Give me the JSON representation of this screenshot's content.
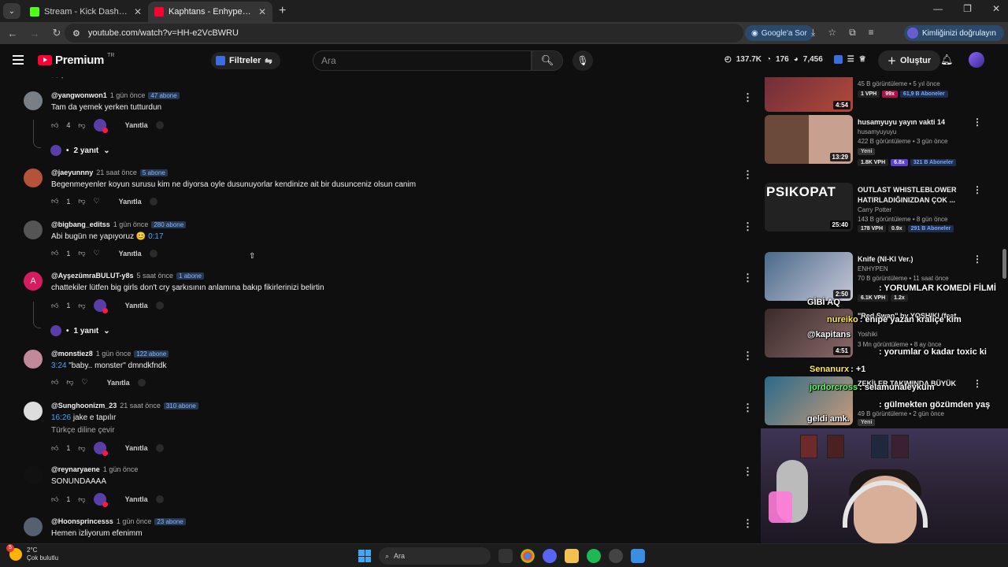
{
  "browser": {
    "tabs": [
      {
        "label": "Stream - Kick Dashboard",
        "favicon_color": "#53fc18",
        "active": false
      },
      {
        "label": "Kaphtans - Enhypen'in Yeni Albü",
        "favicon_color": "#ff0033",
        "active": true
      }
    ],
    "url": "youtube.com/watch?v=HH-e2VcBWRU",
    "google_button": "Google'a Sor",
    "profile_label": "Kimliğinizi doğrulayın"
  },
  "youtube": {
    "logo_text": "Premium",
    "region": "TR",
    "filters_label": "Filtreler",
    "search_placeholder": "Ara",
    "stats": {
      "views": "137.7K",
      "likes": "176",
      "comments": "7,456"
    },
    "create_label": "Oluştur"
  },
  "comments": [
    {
      "user": "@yangwonwon1",
      "time": "1 gün önce",
      "badge": "47 abone",
      "text": "Tam da yemek yerken tutturdun",
      "ts": "",
      "likes": "4",
      "reply": "Yanıtla",
      "creator_heart": true,
      "replies_label": "2 yanıt",
      "avatar_color": "#7a7f87"
    },
    {
      "user": "@jaeyunnny",
      "time": "21 saat önce",
      "badge": "5 abone",
      "text": "Begenmeyenler koyun surusu kim ne diyorsa oyle dusunuyorlar kendinize ait bir dusunceniz olsun canim",
      "ts": "",
      "likes": "1",
      "reply": "Yanıtla",
      "creator_heart": false,
      "replies_label": "",
      "avatar_color": "#b5533a"
    },
    {
      "user": "@bigbang_editss",
      "time": "1 gün önce",
      "badge": "280 abone",
      "text": "Abi bugün ne yapıyoruz 😊",
      "ts": "0:17",
      "likes": "1",
      "reply": "Yanıtla",
      "creator_heart": false,
      "replies_label": "",
      "avatar_color": "#555555"
    },
    {
      "user": "@AyşezümraBULUT-y8s",
      "time": "5 saat önce",
      "badge": "1 abone",
      "text": "chattekiler lütfen big girls don't cry şarkısının anlamına bakıp fikirlerinizi belirtin",
      "ts": "",
      "likes": "1",
      "reply": "Yanıtla",
      "creator_heart": true,
      "replies_label": "1 yanıt",
      "avatar_color": "#d81b60",
      "avatar_letter": "A"
    },
    {
      "user": "@monstiez8",
      "time": "1 gün önce",
      "badge": "122 abone",
      "text": "\"baby.. monster\" dmndkfndk",
      "ts": "3:24",
      "likes": "",
      "reply": "Yanıtla",
      "creator_heart": false,
      "replies_label": "",
      "avatar_color": "#c08a9a"
    },
    {
      "user": "@Sunghoonizm_23",
      "time": "21 saat önce",
      "badge": "310 abone",
      "text": "jake e tapılır",
      "ts": "16:26",
      "text2": "Türkçe diline çevir",
      "likes": "1",
      "reply": "Yanıtla",
      "creator_heart": true,
      "replies_label": "",
      "avatar_color": "#dddddd"
    },
    {
      "user": "@reynaryaene",
      "time": "1 gün önce",
      "badge": "",
      "text": "SONUNDAAAA",
      "ts": "",
      "likes": "1",
      "reply": "Yanıtla",
      "creator_heart": true,
      "replies_label": "",
      "avatar_color": "#111111"
    },
    {
      "user": "@Hoonsprincesss",
      "time": "1 gün önce",
      "badge": "23 abone",
      "text": "Hemen izliyorum efenimm",
      "ts": "",
      "likes": "",
      "reply": "",
      "creator_heart": false,
      "replies_label": "",
      "avatar_color": "#556070"
    }
  ],
  "sidebar_videos": [
    {
      "title": "",
      "channel": "",
      "views": "45 B görüntüleme • 5 yıl önce",
      "duration": "4:54",
      "pills": [
        "1 VPH",
        "99x",
        "61,9 B Aboneler"
      ],
      "thumb_color": "#5a2b3a"
    },
    {
      "title": "husamyuyu yayın vakti 14",
      "channel": "husamyuyuyu",
      "views": "422 B görüntüleme • 3 gün önce",
      "duration": "13:29",
      "new": "Yeni",
      "pills": [
        "1.8K VPH",
        "6.8x",
        "321 B Aboneler"
      ],
      "thumb_color": "#6b4a3a"
    },
    {
      "title": "OUTLAST WHISTLEBLOWER HATIRLADIĞINIZDAN ÇOK ...",
      "channel": "Carry Potter",
      "views": "143 B görüntüleme • 8 gün önce",
      "duration": "25:40",
      "thumb_text": "PSIKOPAT",
      "pills": [
        "178 VPH",
        "0.9x",
        "291 B Aboneler"
      ],
      "thumb_color": "#2a2a2a"
    },
    {
      "title": "Knife (NI-KI Ver.)",
      "channel": "ENHYPEN",
      "views": "70 B görüntüleme • 11 saat önce",
      "duration": "2:50",
      "pills": [
        "6.1K VPH",
        "1.2x"
      ],
      "thumb_color": "#4a6a8a"
    },
    {
      "title": "\"Red Swan\" by YOSHIKI (feat.",
      "channel": "Yoshiki",
      "views": "3 Mn görüntüleme • 8 ay önce",
      "duration": "4:51",
      "pills": [],
      "thumb_color": "#3a2a2a"
    },
    {
      "title": "ZEKİLER TAKIMINDA BÜYÜK",
      "channel": "",
      "views": "49 B görüntüleme • 2 gün önce",
      "duration": "",
      "new": "Yeni",
      "pills": [],
      "thumb_color": "#2a6a8a"
    }
  ],
  "chat_overlay": [
    {
      "user": "",
      "msg": ": YORUMLAR KOMEDİ FİLMİ",
      "color": "#ff4da6"
    },
    {
      "user": "",
      "msg": "GİBİ AQ",
      "color": "#ffffff"
    },
    {
      "user": "nureiko",
      "msg": ": enipe yazan kraliçe kim",
      "color": "#ffe94d"
    },
    {
      "user": "@kapitans",
      "msg": "",
      "color": "#ffffff"
    },
    {
      "user": "",
      "msg": ": yorumlar o kadar toxic ki",
      "color": "#ff4da6"
    },
    {
      "user": "Senanurx",
      "msg": ": +1",
      "color": "#ffe94d"
    },
    {
      "user": "jordorcross",
      "msg": ": selamunaleyküm",
      "color": "#5dff5d"
    },
    {
      "user": "",
      "msg": ": gülmekten gözümden yaş",
      "color": "#ff4d4d"
    },
    {
      "user": "",
      "msg": "geldi amk.",
      "color": "#ffffff"
    }
  ],
  "taskbar": {
    "temp": "2°C",
    "weather": "Çok bulutlu",
    "notifications": "5",
    "search_placeholder": "Ara"
  }
}
